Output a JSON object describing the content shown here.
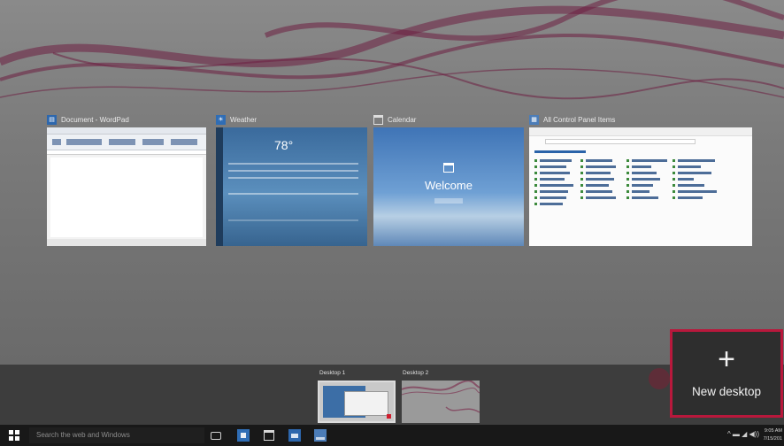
{
  "windows": [
    {
      "title": "Document - WordPad",
      "icon": "wordpad-icon"
    },
    {
      "title": "Weather",
      "icon": "weather-icon",
      "temperature": "78°"
    },
    {
      "title": "Calendar",
      "icon": "calendar-icon",
      "welcome_text": "Welcome"
    },
    {
      "title": "All Control Panel Items",
      "icon": "control-panel-icon"
    }
  ],
  "desktops": [
    {
      "label": "Desktop 1",
      "selected": true
    },
    {
      "label": "Desktop 2",
      "selected": false
    }
  ],
  "new_desktop": {
    "plus": "+",
    "label": "New desktop"
  },
  "taskbar": {
    "search_placeholder": "Search the web and Windows",
    "tray_icons": "^ ▬ ◢ ◀))",
    "time": "9:05 AM",
    "date": "7/15/201"
  },
  "colors": {
    "accent": "#b8183c",
    "taskbar": "#181818",
    "strip": "#3d3d3d"
  }
}
